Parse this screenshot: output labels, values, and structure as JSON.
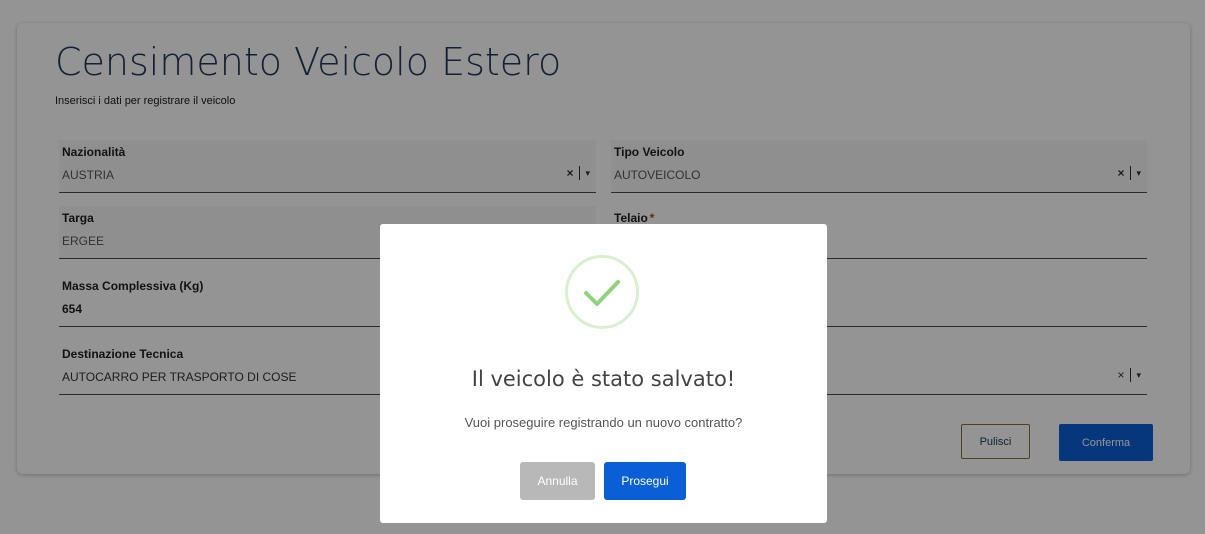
{
  "page": {
    "title": "Censimento Veicolo Estero",
    "subtitle": "Inserisci i dati per registrare il veicolo"
  },
  "form": {
    "nazionalita": {
      "label": "Nazionalità",
      "value": "AUSTRIA"
    },
    "tipo_veicolo": {
      "label": "Tipo Veicolo",
      "value": "AUTOVEICOLO"
    },
    "targa": {
      "label": "Targa",
      "value": "ERGEE"
    },
    "telaio": {
      "label": "Telaio",
      "required_mark": "*"
    },
    "massa": {
      "label": "Massa Complessiva (Kg)",
      "value": "654"
    },
    "destinazione": {
      "label": "Destinazione Tecnica",
      "value": "AUTOCARRO PER TRASPORTO DI COSE"
    },
    "clear_symbol": "×",
    "caret_symbol": "▾"
  },
  "actions": {
    "pulisci": "Pulisci",
    "conferma": "Conferma"
  },
  "modal": {
    "title": "Il veicolo è stato salvato!",
    "message": "Vuoi proseguire registrando un nuovo contratto?",
    "cancel_label": "Annulla",
    "confirm_label": "Prosegui",
    "icon": "check-icon"
  },
  "colors": {
    "primary": "#0b5fd6",
    "title": "#243a56",
    "success": "#8fd47b",
    "cancel": "#b8b8b8"
  }
}
